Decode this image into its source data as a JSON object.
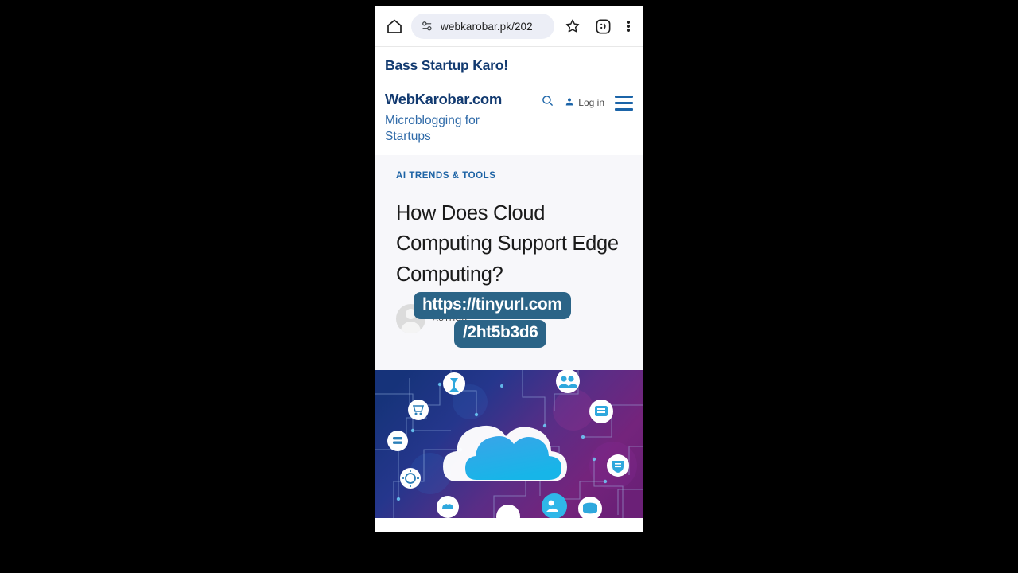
{
  "browser": {
    "url": "webkarobar.pk/202",
    "home_icon": "home-icon",
    "lock_icon": "page-info-icon",
    "bookmark_icon": "star-icon",
    "profile_icon": "emoji-face-icon",
    "profile_label": ":D",
    "menu_icon": "three-dot-menu-icon"
  },
  "site": {
    "slogan": "Bass Startup Karo!",
    "name": "WebKarobar.com",
    "tagline": "Microblogging for Startups",
    "search_icon": "search-icon",
    "login_label": "Log in",
    "login_icon": "user-icon",
    "menu_icon": "hamburger-menu-icon",
    "logo_alt": "AI",
    "brand_color": "#123a70",
    "link_color": "#2f6aa8",
    "accent_color": "#1b64a8"
  },
  "article": {
    "kicker": "AI TRENDS & TOOLS",
    "headline": "How Does Cloud Computing Support Edge Computing?",
    "author": "AUTHOR",
    "avatar_icon": "avatar-placeholder-icon",
    "hero_alt": "cloud-computing-illustration"
  },
  "overlay": {
    "url_line1": "https://tinyurl.com",
    "url_line2": "/2ht5b3d6",
    "background_color": "#2b6487",
    "text_color": "#ffffff"
  }
}
